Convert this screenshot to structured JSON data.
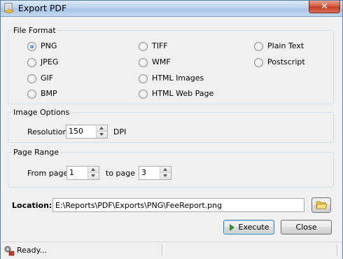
{
  "window": {
    "title": "Export PDF",
    "close_glyph": "✕",
    "icon": "export-app-icon"
  },
  "file_format": {
    "legend": "File Format",
    "options": [
      "PNG",
      "JPEG",
      "GIF",
      "BMP",
      "TIFF",
      "WMF",
      "HTML Images",
      "HTML Web Page",
      "Plain Text",
      "Postscript"
    ],
    "selected": "PNG"
  },
  "image_options": {
    "legend": "Image Options",
    "resolution_label": "Resolution:",
    "resolution_value": "150",
    "unit": "DPI"
  },
  "page_range": {
    "legend": "Page Range",
    "from_label": "From page",
    "from_value": "1",
    "to_label": "to page",
    "to_value": "3"
  },
  "location": {
    "label": "Location:",
    "path": "E:\\Reports\\PDF\\Exports\\PNG\\FeeReport.png",
    "browse_icon": "folder-open-icon"
  },
  "buttons": {
    "execute": "Execute",
    "close": "Close"
  },
  "status": {
    "text": "Ready...",
    "icon": "status-gear-icon"
  },
  "colors": {
    "accent": "#1e5fb0",
    "execute_arrow": "#2e8b2e"
  }
}
